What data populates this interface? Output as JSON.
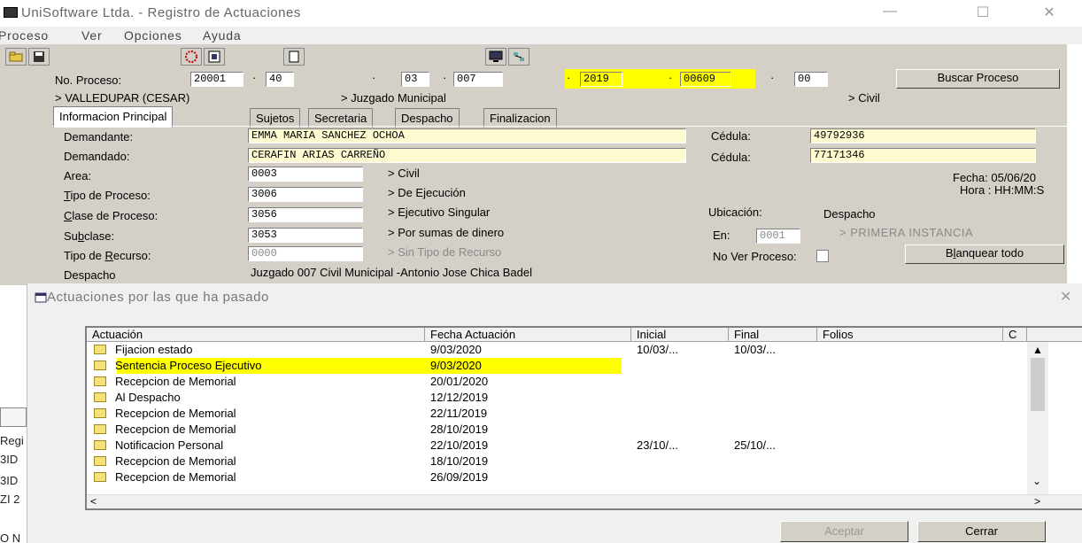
{
  "window": {
    "title": "UniSoftware Ltda. - Registro de Actuaciones",
    "minimize": "—",
    "maximize": "☐",
    "close": "✕"
  },
  "menu": [
    "Proceso",
    "Ver",
    "Opciones",
    "Ayuda"
  ],
  "proceso": {
    "label": "No. Proceso:",
    "parts": [
      "20001",
      "40",
      "03",
      "007",
      "2019",
      "00609",
      "00"
    ],
    "buscar": "Buscar Proceso"
  },
  "breadcrumb": [
    "> VALLEDUPAR (CESAR)",
    "> Juzgado Municipal",
    "> Civil"
  ],
  "tabs": [
    "Informacion Principal",
    "Sujetos",
    "Secretaria",
    "Despacho",
    "Finalizacion"
  ],
  "form": {
    "demandante_label": "Demandante:",
    "demandante": "EMMA MARIA SANCHEZ OCHOA",
    "demandado_label": "Demandado:",
    "demandado": "CERAFIN ARIAS CARREÑO",
    "cedula_label": "Cédula:",
    "cedula1": "49792936",
    "cedula2": "77171346",
    "area_label": "Area:",
    "area_code": "0003",
    "area_desc": "> Civil",
    "tipo_label": "Tipo de Proceso:",
    "tipo_code": "3006",
    "tipo_desc": "> De Ejecución",
    "clase_label": "Clase de Proceso:",
    "clase_code": "3056",
    "clase_desc": "> Ejecutivo Singular",
    "subclase_label": "Subclase:",
    "subclase_code": "3053",
    "subclase_desc": "> Por sumas de dinero",
    "recurso_label": "Tipo de Recurso:",
    "recurso_code": "0000",
    "recurso_desc": "> Sin Tipo de Recurso",
    "despacho_label": "Despacho",
    "despacho": "Juzgado  007 Civil Municipal -Antonio Jose Chica Badel",
    "fecha": "Fecha:  05/06/20",
    "hora": "Hora :  HH:MM:S",
    "ubicacion_label": "Ubicación:",
    "ubicacion": "Despacho",
    "en_label": "En:",
    "en_code": "0001",
    "instancia": "> PRIMERA INSTANCIA",
    "no_ver": "No Ver Proceso:",
    "blanquear": "Blanquear todo"
  },
  "dialog": {
    "title": "Actuaciones por las que ha pasado",
    "columns": [
      "Actuación",
      "Fecha Actuación",
      "Inicial",
      "Final",
      "Folios",
      "C"
    ],
    "rows": [
      {
        "actuacion": "Fijacion estado",
        "fecha": "9/03/2020",
        "inicial": "10/03/...",
        "final": "10/03/..."
      },
      {
        "actuacion": "Sentencia Proceso Ejecutivo",
        "fecha": "9/03/2020",
        "inicial": "",
        "final": ""
      },
      {
        "actuacion": "Recepcion de Memorial",
        "fecha": "20/01/2020",
        "inicial": "",
        "final": ""
      },
      {
        "actuacion": "Al Despacho",
        "fecha": "12/12/2019",
        "inicial": "",
        "final": ""
      },
      {
        "actuacion": "Recepcion de Memorial",
        "fecha": "22/11/2019",
        "inicial": "",
        "final": ""
      },
      {
        "actuacion": "Recepcion de Memorial",
        "fecha": "28/10/2019",
        "inicial": "",
        "final": ""
      },
      {
        "actuacion": "Notificacion Personal",
        "fecha": "22/10/2019",
        "inicial": "23/10/...",
        "final": "25/10/..."
      },
      {
        "actuacion": "Recepcion de Memorial",
        "fecha": "18/10/2019",
        "inicial": "",
        "final": ""
      },
      {
        "actuacion": "Recepcion de Memorial",
        "fecha": "26/09/2019",
        "inicial": "",
        "final": ""
      }
    ],
    "aceptar": "Aceptar",
    "cerrar": "Cerrar",
    "close": "✕"
  },
  "left_strip": [
    "Regi",
    "3ID",
    "3ID",
    "ZI 2",
    "O N"
  ]
}
